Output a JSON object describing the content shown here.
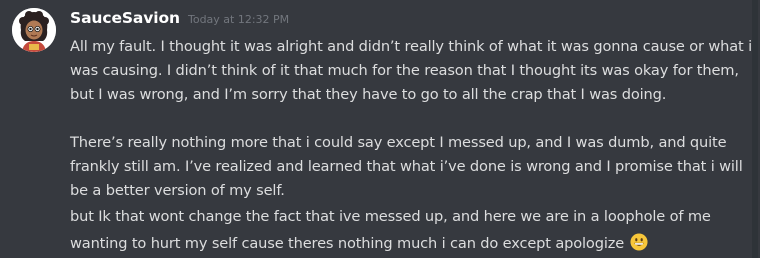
{
  "message": {
    "username": "SauceSavion",
    "timestamp": "Today at 12:32 PM",
    "paragraph1": [
      "All my fault. I thought it was alright and didn’t really think of what it was gonna cause or what i",
      "was causing. I didn’t think of it that much for the reason that I thought its was okay for them,",
      "but I was wrong, and I’m sorry that they have to go to all the crap that I was doing."
    ],
    "paragraph2": [
      "There’s really nothing more that i could say except I messed up, and I was dumb, and quite",
      "frankly still am. I’ve realized and learned that what i’ve done is wrong and I promise that i will",
      "be a better version of my self."
    ],
    "paragraph3": [
      "but Ik that wont change the fact that ive messed up, and here we are in a loophole of me",
      "wanting to hurt my self cause theres nothing much i can do except apologize"
    ],
    "emoji": "grinning-face-emoji"
  },
  "colors": {
    "background": "#36393f",
    "username": "#ffffff",
    "timestamp": "#72767d",
    "text": "#dcddde",
    "emoji": "#f7c63a"
  }
}
